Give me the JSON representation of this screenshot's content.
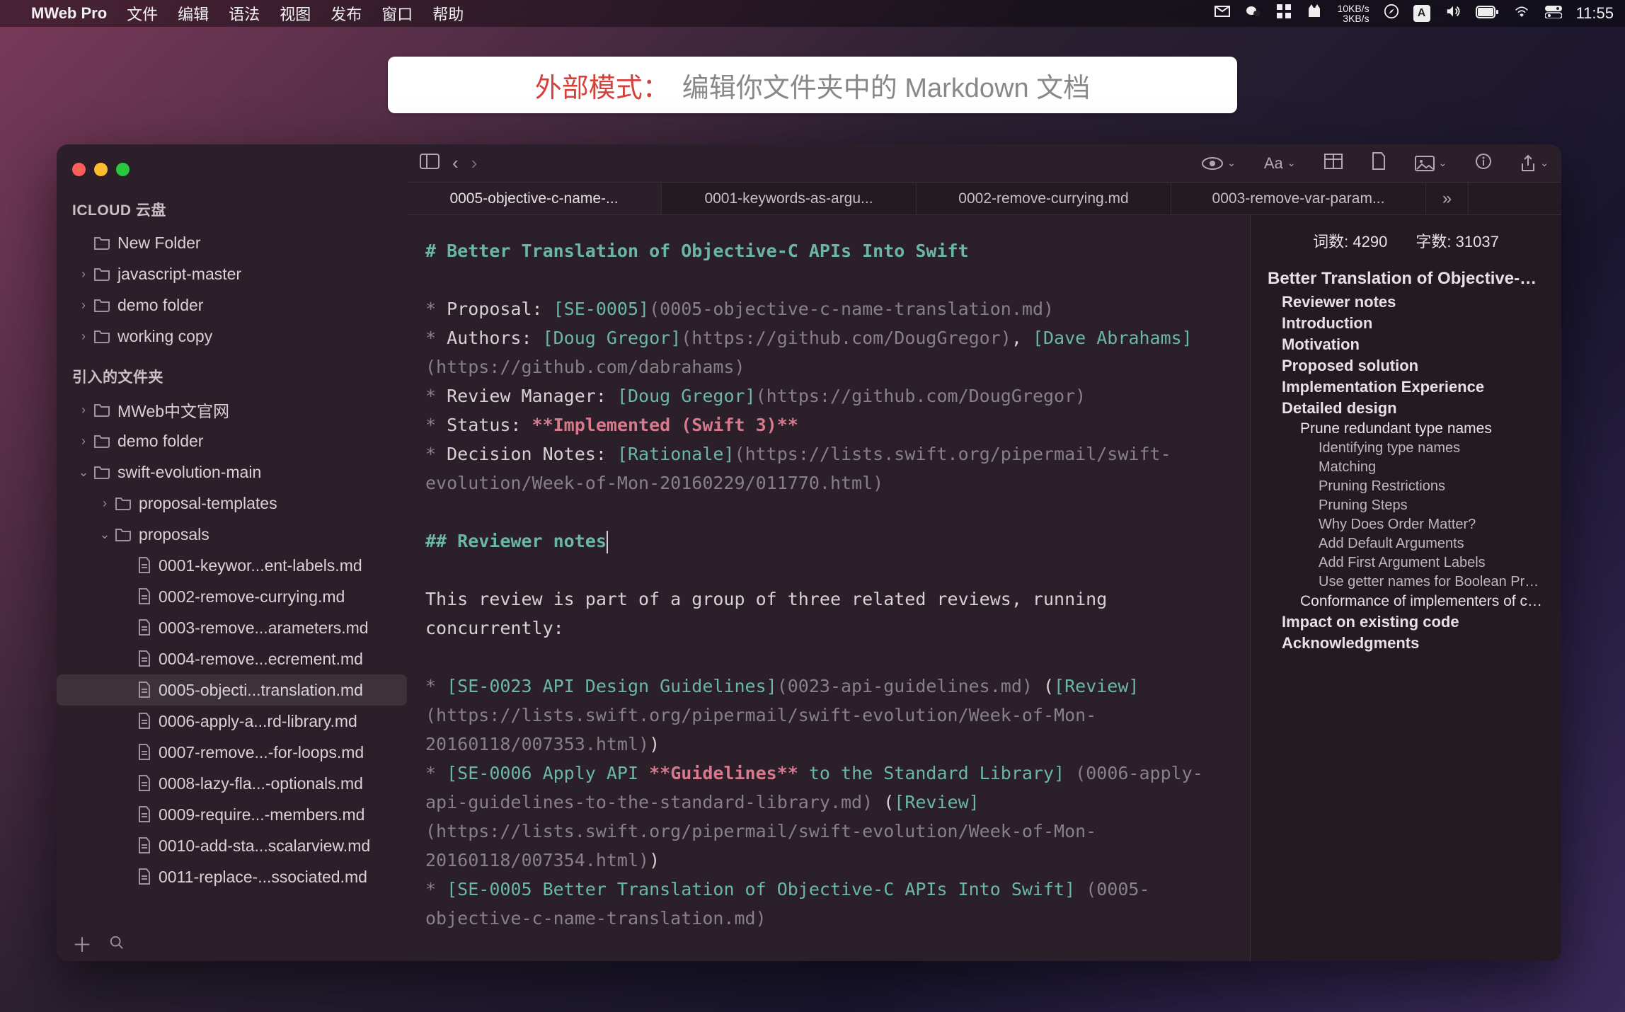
{
  "menubar": {
    "app": "MWeb Pro",
    "items": [
      "文件",
      "编辑",
      "语法",
      "视图",
      "发布",
      "窗口",
      "帮助"
    ],
    "netUp": "10KB/s",
    "netDown": "3KB/s",
    "clock": "11:55"
  },
  "banner": {
    "title": "外部模式：",
    "sub": "编辑你文件夹中的 Markdown 文档"
  },
  "sidebar": {
    "section1": "ICLOUD 云盘",
    "section2": "引入的文件夹",
    "items1": [
      {
        "chev": "",
        "label": "New Folder",
        "kind": "folder"
      },
      {
        "chev": "›",
        "label": "javascript-master",
        "kind": "folder"
      },
      {
        "chev": "›",
        "label": "demo folder",
        "kind": "folder"
      },
      {
        "chev": "›",
        "label": "working copy",
        "kind": "folder"
      }
    ],
    "items2": [
      {
        "chev": "›",
        "label": "MWeb中文官网",
        "kind": "folder",
        "indent": 0
      },
      {
        "chev": "›",
        "label": "demo folder",
        "kind": "folder",
        "indent": 0
      },
      {
        "chev": "⌄",
        "label": "swift-evolution-main",
        "kind": "folder",
        "indent": 0
      },
      {
        "chev": "›",
        "label": "proposal-templates",
        "kind": "folder",
        "indent": 1
      },
      {
        "chev": "⌄",
        "label": "proposals",
        "kind": "folder",
        "indent": 1
      },
      {
        "chev": "",
        "label": "0001-keywor...ent-labels.md",
        "kind": "file",
        "indent": 2
      },
      {
        "chev": "",
        "label": "0002-remove-currying.md",
        "kind": "file",
        "indent": 2
      },
      {
        "chev": "",
        "label": "0003-remove...arameters.md",
        "kind": "file",
        "indent": 2
      },
      {
        "chev": "",
        "label": "0004-remove...ecrement.md",
        "kind": "file",
        "indent": 2
      },
      {
        "chev": "",
        "label": "0005-objecti...translation.md",
        "kind": "file",
        "indent": 2,
        "selected": true
      },
      {
        "chev": "",
        "label": "0006-apply-a...rd-library.md",
        "kind": "file",
        "indent": 2
      },
      {
        "chev": "",
        "label": "0007-remove...-for-loops.md",
        "kind": "file",
        "indent": 2
      },
      {
        "chev": "",
        "label": "0008-lazy-fla...-optionals.md",
        "kind": "file",
        "indent": 2
      },
      {
        "chev": "",
        "label": "0009-require...-members.md",
        "kind": "file",
        "indent": 2
      },
      {
        "chev": "",
        "label": "0010-add-sta...scalarview.md",
        "kind": "file",
        "indent": 2
      },
      {
        "chev": "",
        "label": "0011-replace-...ssociated.md",
        "kind": "file",
        "indent": 2
      }
    ]
  },
  "tabs": [
    "0005-objective-c-name-...",
    "0001-keywords-as-argu...",
    "0002-remove-currying.md",
    "0003-remove-var-param..."
  ],
  "toolbar": {
    "font_label": "Aa"
  },
  "counts": {
    "word_label": "词数:",
    "word_value": "4290",
    "char_label": "字数:",
    "char_value": "31037"
  },
  "outline": {
    "h1": "Better Translation of Objective-C...",
    "items": [
      {
        "lvl": 2,
        "t": "Reviewer notes"
      },
      {
        "lvl": 2,
        "t": "Introduction"
      },
      {
        "lvl": 2,
        "t": "Motivation"
      },
      {
        "lvl": 2,
        "t": "Proposed solution"
      },
      {
        "lvl": 2,
        "t": "Implementation Experience"
      },
      {
        "lvl": 2,
        "t": "Detailed design"
      },
      {
        "lvl": 3,
        "t": "Prune redundant type names"
      },
      {
        "lvl": 4,
        "t": "Identifying type names"
      },
      {
        "lvl": 4,
        "t": "Matching"
      },
      {
        "lvl": 4,
        "t": "Pruning Restrictions"
      },
      {
        "lvl": 4,
        "t": "Pruning Steps"
      },
      {
        "lvl": 4,
        "t": "  Why Does Order Matter?"
      },
      {
        "lvl": 4,
        "t": "Add Default Arguments"
      },
      {
        "lvl": 4,
        "t": "Add First Argument Labels"
      },
      {
        "lvl": 4,
        "t": "Use getter names for Boolean Proper..."
      },
      {
        "lvl": 3,
        "t": "Conformance of implementers of co..."
      },
      {
        "lvl": 2,
        "t": "Impact on existing code"
      },
      {
        "lvl": 2,
        "t": "Acknowledgments"
      }
    ]
  },
  "doc": {
    "title": "# Better Translation of Objective-C APIs Into Swift",
    "l1a": "* ",
    "l1b": "Proposal: ",
    "l1c": "[SE-0005]",
    "l1d": "(0005-objective-c-name-translation.md)",
    "l2a": "* ",
    "l2b": "Authors: ",
    "l2c": "[Doug Gregor]",
    "l2d": "(https://github.com/DougGregor)",
    "l2e": ", ",
    "l2f": "[Dave Abrahams]",
    "l2g": "(https://github.com/dabrahams)",
    "l3a": "* ",
    "l3b": "Review Manager: ",
    "l3c": "[Doug Gregor]",
    "l3d": "(https://github.com/DougGregor)",
    "l4a": "* ",
    "l4b": "Status: ",
    "l4c": "**Implemented (Swift 3)**",
    "l5a": "* ",
    "l5b": "Decision Notes: ",
    "l5c": "[Rationale]",
    "l5d": "(https://lists.swift.org/pipermail/swift-evolution/Week-of-Mon-20160229/011770.html)",
    "h2": "## Reviewer notes",
    "p1": "This review is part of a group of three related reviews, running concurrently:",
    "b1a": "* ",
    "b1b": "[SE-0023 API Design Guidelines]",
    "b1c": "(0023-api-guidelines.md)",
    "b1d": " (",
    "b1e": "[Review]",
    "b1f": "(https://lists.swift.org/pipermail/swift-evolution/Week-of-Mon-20160118/007353.html)",
    "b1g": ")",
    "b2a": "* ",
    "b2b": "[SE-0006 Apply API ",
    "b2c": "**Guidelines**",
    "b2d": " to the Standard Library]",
    "b2e": " (0006-apply-api-guidelines-to-the-standard-library.md)",
    "b2f": " (",
    "b2g": "[Review]",
    "b2h": "(https://lists.swift.org/pipermail/swift-evolution/Week-of-Mon-20160118/007354.html)",
    "b2i": ")",
    "b3a": "* ",
    "b3b": "[SE-0005 Better Translation of Objective-C APIs Into Swift]",
    "b3c": " (0005-objective-c-name-translation.md)"
  }
}
